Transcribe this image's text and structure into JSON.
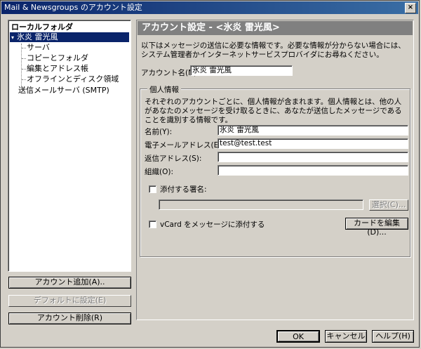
{
  "window": {
    "title": "Mail & Newsgroups のアカウント設定",
    "close_glyph": "×"
  },
  "tree": {
    "items": [
      {
        "label": "ローカルフォルダ"
      },
      {
        "twisty": "▾",
        "label": "氷炎  雷光風"
      },
      {
        "label": "サーバ"
      },
      {
        "label": "コピーとフォルダ"
      },
      {
        "label": "編集とアドレス帳"
      },
      {
        "label": "オフラインとディスク領域"
      },
      {
        "label": "送信メールサーバ (SMTP)"
      }
    ]
  },
  "left_buttons": {
    "add": "アカウント追加(A)..",
    "default": "デフォルトに設定(E)",
    "delete": "アカウント削除(R)"
  },
  "panel": {
    "header": "アカウント設定 - <氷炎  雷光風>",
    "description": "以下はメッセージの送信に必要な情報です。必要な情報が分からない場合には、システム管理者かインターネットサービスプロバイダにお尋ねください。",
    "account_name_label": "アカウント名(N):",
    "account_name_value": "氷炎  雷光風",
    "identity": {
      "legend": "個人情報",
      "description": "それぞれのアカウントごとに、個人情報が含まれます。個人情報とは、他の人があなたのメッセージを受け取るときに、あなたが送信したメッセージであることを識別する情報です。",
      "name_label": "名前(Y):",
      "name_value": "氷炎  雷光風",
      "email_label": "電子メールアドレス(E):",
      "email_value": "test@test.test",
      "reply_label": "返信アドレス(S):",
      "reply_value": "",
      "org_label": "組織(O):",
      "org_value": "",
      "signature_label": "添付する署名:",
      "signature_value": "",
      "choose_button": "選択(C)...",
      "vcard_label": "vCard をメッセージに添付する",
      "edit_card_button": "カードを編集(D)..."
    }
  },
  "footer": {
    "ok": "OK",
    "cancel": "キャンセル",
    "help": "ヘルプ(H)"
  }
}
